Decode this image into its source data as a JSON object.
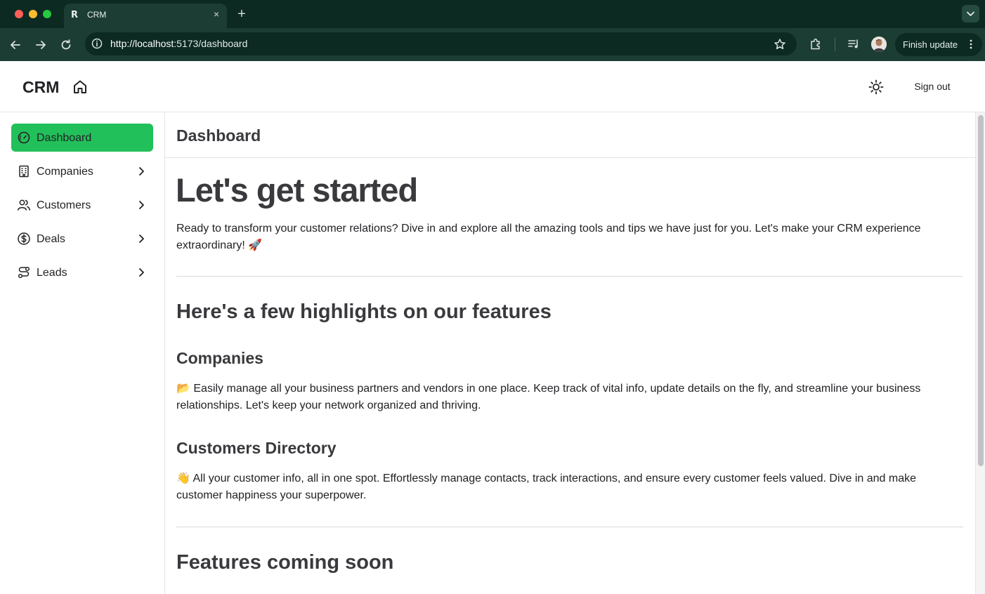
{
  "browser": {
    "tab_title": "CRM",
    "tab_favicon": "R",
    "tab_close": "×",
    "new_tab": "+",
    "url_host": "http://localhost",
    "url_rest": ":5173/dashboard",
    "update_label": "Finish update"
  },
  "header": {
    "brand": "CRM",
    "sign_out": "Sign out"
  },
  "sidebar": {
    "items": [
      {
        "label": "Dashboard",
        "icon": "gauge-icon",
        "active": true
      },
      {
        "label": "Companies",
        "icon": "building-icon"
      },
      {
        "label": "Customers",
        "icon": "users-icon"
      },
      {
        "label": "Deals",
        "icon": "dollar-circle-icon"
      },
      {
        "label": "Leads",
        "icon": "route-icon"
      }
    ]
  },
  "main": {
    "page_title": "Dashboard",
    "hero_title": "Let's get started",
    "intro": "Ready to transform your customer relations? Dive in and explore all the amazing tools and tips we have just for you. Let's make your CRM experience extraordinary! 🚀",
    "highlights_heading": "Here's a few highlights on our features",
    "companies_heading": "Companies",
    "companies_text": "📂 Easily manage all your business partners and vendors in one place. Keep track of vital info, update details on the fly, and streamline your business relationships. Let's keep your network organized and thriving.",
    "customers_heading": "Customers Directory",
    "customers_text": "👋 All your customer info, all in one spot. Effortlessly manage contacts, track interactions, and ensure every customer feels valued. Dive in and make customer happiness your superpower.",
    "coming_soon_heading": "Features coming soon"
  },
  "colors": {
    "accent": "#22c05a",
    "chrome_dark": "#0c2a22",
    "chrome_toolbar": "#1c3d33"
  }
}
